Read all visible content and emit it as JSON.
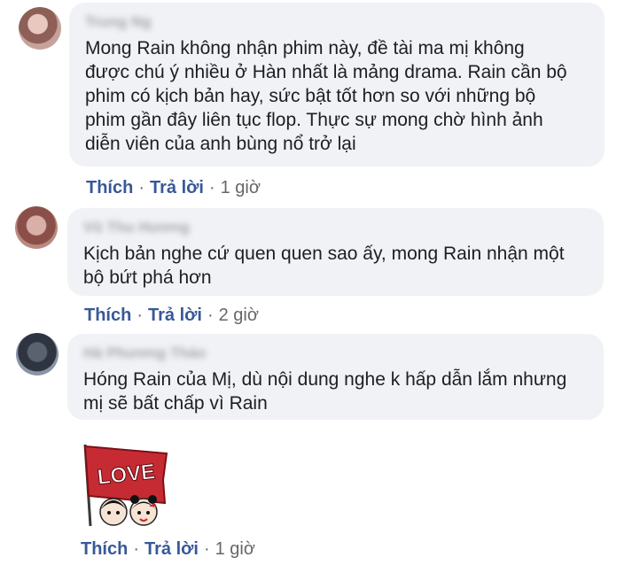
{
  "comments": [
    {
      "author": "Trung Ng",
      "text": "Mong Rain không nhận phim này, đề tài ma mị không\nđược chú ý nhiều ở Hàn nhất là mảng drama. Rain cần bộ\nphim có kịch bản hay, sức bật tốt hơn so với những bộ\nphim gần đây liên tục flop. Thực sự mong chờ hình ảnh\ndiễn viên của anh bùng nổ trở lại",
      "like": "Thích",
      "reply": "Trả lời",
      "sep": "·",
      "time": "1 giờ"
    },
    {
      "author": "Vũ Thu Hương",
      "text": "Kịch bản nghe cứ quen quen sao ấy, mong Rain nhận một\nbộ bứt phá hơn",
      "like": "Thích",
      "reply": "Trả lời",
      "sep": "·",
      "time": "2 giờ"
    },
    {
      "author": "Hà Phương Thảo",
      "text": "Hóng Rain của Mị, dù nội dung nghe k hấp dẫn lắm nhưng\nmị sẽ bất chấp vì Rain",
      "sticker": {
        "text": "LOVE",
        "icon": "love-flag-sticker"
      },
      "like": "Thích",
      "reply": "Trả lời",
      "sep": "·",
      "time": "1 giờ"
    }
  ],
  "colors": {
    "bubble": "#f0f2f5",
    "action_link": "#385898",
    "meta_gray": "#65676b",
    "body_text": "#1c1e21",
    "sticker_red": "#c62b33"
  }
}
